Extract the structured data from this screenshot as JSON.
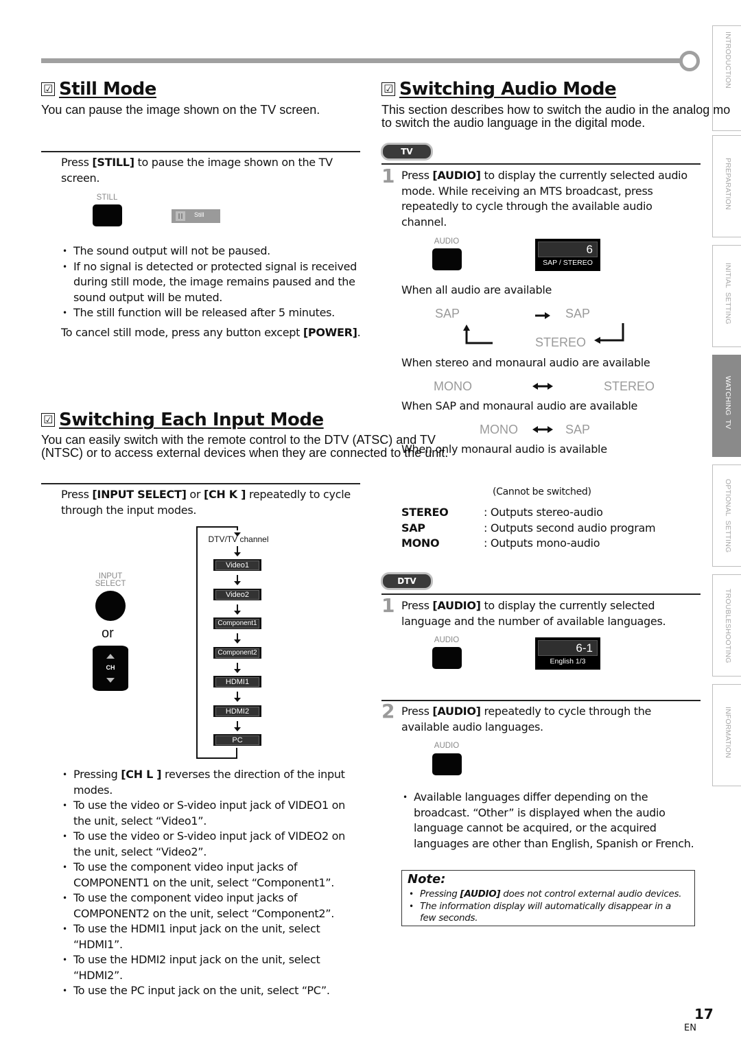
{
  "side_tabs": [
    {
      "label": "INTRODUCTION",
      "active": false
    },
    {
      "label": "PREPARATION",
      "active": false
    },
    {
      "label": "INITIAL  SETTING",
      "active": false
    },
    {
      "label": "WATCHING  TV",
      "active": true
    },
    {
      "label": "OPTIONAL  SETTING",
      "active": false
    },
    {
      "label": "TROUBLESHOOTING",
      "active": false
    },
    {
      "label": "INFORMATION",
      "active": false
    }
  ],
  "still_mode": {
    "checkbox": "☑",
    "title": "Still Mode",
    "intro": "You can pause the image shown on the TV screen.",
    "instruction_pre": "Press ",
    "instruction_key": "[STILL]",
    "instruction_post": " to pause the image shown on the TV screen.",
    "button_label": "STILL",
    "osd_label": "Still",
    "bullets": [
      "The sound output will not be paused.",
      "If no signal is detected or protected signal is received during still mode, the image remains paused and the sound output will be muted.",
      "The still function will be released after 5 minutes."
    ],
    "cancel_pre": "To cancel still mode, press any button except ",
    "cancel_key": "[POWER]",
    "cancel_post": "."
  },
  "input_mode": {
    "checkbox": "☑",
    "title": "Switching Each Input Mode",
    "intro_line1": "You can easily switch with the remote control to the DTV (ATSC) and TV",
    "intro_line2": "(NTSC) or to access external devices when they are connected to the unit.",
    "instruction_pre": "Press ",
    "instruction_key1": "[INPUT SELECT]",
    "instruction_mid": " or ",
    "instruction_key2": "[CH K ]",
    "instruction_post": " repeatedly to cycle through the input modes.",
    "input_select_label_1": "INPUT",
    "input_select_label_2": "SELECT",
    "or_label": "or",
    "ch_label": "CH",
    "flow_start": "DTV/TV channel",
    "flow_items": [
      "Video1",
      "Video2",
      "Component1",
      "Component2",
      "HDMI1",
      "HDMI2",
      "PC"
    ],
    "bullet_first_pre": "Pressing ",
    "bullet_first_key": "[CH L ]",
    "bullet_first_post": " reverses the direction of the input modes.",
    "bullets": [
      "To use the video or S-video input jack of VIDEO1 on the unit, select “Video1”.",
      "To use the video or S-video input jack of VIDEO2 on the unit, select “Video2”.",
      "To use the component video input jacks of COMPONENT1 on the unit, select “Component1”.",
      "To use the component video input jacks of COMPONENT2 on the unit, select “Component2”.",
      "To use the HDMI1 input jack on the unit, select “HDMI1”.",
      "To use the HDMI2 input jack on the unit, select “HDMI2”.",
      "To use the PC input jack on the unit, select “PC”."
    ]
  },
  "audio_mode": {
    "checkbox": "☑",
    "title": "Switching Audio Mode",
    "intro_line1": "This section describes how to switch the audio in the analog mo",
    "intro_line2": "to switch the audio language in the digital mode.",
    "tv_badge": "TV",
    "tv_step_num": "1",
    "tv_step_pre": "Press ",
    "tv_step_key": "[AUDIO]",
    "tv_step_post": " to display the currently selected audio mode. While receiving an MTS broadcast, press repeatedly to cycle through the available audio channel.",
    "audio_button_label": "AUDIO",
    "tv_osd_channel": "6",
    "tv_osd_sub": "SAP / STEREO",
    "case_all": "When all audio are available",
    "case_all_words": [
      "SAP",
      "SAP",
      "STEREO"
    ],
    "case_stereo_mono": "When stereo and monaural audio are available",
    "case_stereo_mono_words": [
      "MONO",
      "STEREO"
    ],
    "case_sap_mono": "When SAP and monaural audio are available",
    "case_sap_mono_words": [
      "MONO",
      "SAP"
    ],
    "case_mono_only": "When only monaural audio is available",
    "cannot_switch": "(Cannot be switched)",
    "definitions": [
      {
        "term": "STEREO",
        "desc": ": Outputs stereo-audio"
      },
      {
        "term": "SAP",
        "desc": ": Outputs second audio program"
      },
      {
        "term": "MONO",
        "desc": ": Outputs mono-audio"
      }
    ],
    "dtv_badge": "DTV",
    "dtv_step1_num": "1",
    "dtv_step1_pre": "Press ",
    "dtv_step1_key": "[AUDIO]",
    "dtv_step1_post": " to display the currently selected language and the number of available languages.",
    "dtv_osd_channel": "6-1",
    "dtv_osd_sub": "English 1/3",
    "dtv_step2_num": "2",
    "dtv_step2_pre": "Press ",
    "dtv_step2_key": "[AUDIO]",
    "dtv_step2_post": " repeatedly to cycle through the available audio languages.",
    "dtv_bullet": "Available languages differ depending on the broadcast. “Other” is displayed when the audio language cannot be acquired, or the acquired languages are other than English, Spanish or French.",
    "note_title": "Note:",
    "note_item1_pre": "Pressing ",
    "note_item1_key": "[AUDIO]",
    "note_item1_post": " does not control external audio devices.",
    "note_item2": "The information display will automatically disappear in a few seconds."
  },
  "footer": {
    "page_number": "17",
    "language": "EN"
  }
}
